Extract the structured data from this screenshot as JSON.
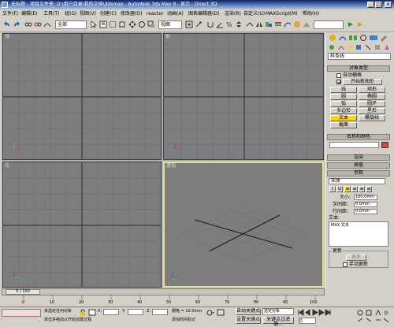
{
  "window": {
    "title": "无标题 - 项目文件夹: D:\\用户目录\\我的文档\\3dsmax - Autodesk 3ds Max 9 - 显示 : Direct 3D",
    "minimize": "_",
    "maximize": "□",
    "close": "×"
  },
  "menu": [
    "文件(F)",
    "编辑(E)",
    "工具(T)",
    "组(G)",
    "视图(V)",
    "创建(C)",
    "修改器(O)",
    "reactor",
    "动画(A)",
    "图表编辑器(D)",
    "渲染(R)",
    "自定义(U)",
    "MAXScript(M)",
    "帮助(H)"
  ],
  "toolbar": {
    "selection_filter": "全部",
    "coord_system": "视图",
    "named_selection": ""
  },
  "viewports": {
    "top": "顶",
    "front": "前",
    "left": "左",
    "perspective": "透视"
  },
  "command_panel": {
    "category_dropdown": "样条线",
    "object_type": {
      "title": "对象类型",
      "autogrid": "自动栅格",
      "start_new_shape": "开始新图形",
      "buttons": [
        "线",
        "矩形",
        "圆",
        "椭圆",
        "弧",
        "圆环",
        "多边形",
        "星形",
        "文本",
        "螺旋线",
        "截面"
      ]
    },
    "name_color": {
      "title": "名称和颜色"
    },
    "rendering": {
      "title": "渲染"
    },
    "interpolation": {
      "title": "插值"
    },
    "parameters": {
      "title": "参数",
      "font": "宋体",
      "style_buttons": [
        "I",
        "U",
        "≡",
        "≡",
        "≡",
        "≡"
      ],
      "size_label": "大小:",
      "size_value": "100.0mm",
      "kerning_label": "字间距:",
      "kerning_value": "0.0mm",
      "leading_label": "行间距:",
      "leading_value": "0.0mm",
      "text_label": "文本:",
      "text_value": "MAX 文本",
      "update_group": "更新",
      "update_button": "更新",
      "manual_update": "手动更新"
    }
  },
  "time": {
    "slider_label": "0 / 100",
    "ticks": [
      "0",
      "10",
      "20",
      "30",
      "40",
      "50",
      "60",
      "70",
      "80",
      "90",
      "100"
    ]
  },
  "status": {
    "line1": "未选定任何对象",
    "line2": "单击并拖动以开始创建过程",
    "grid_label": "栅格 = 10.0mm",
    "auto_key": "自动关键点",
    "set_key": "设置关键点",
    "key_filter_btn": "关键点过滤器...",
    "selected_objects": "选定对象",
    "add_time_tag": "添加时间标记",
    "x_label": "X:",
    "y_label": "Y:",
    "z_label": "Z:",
    "frame_value": "0"
  },
  "colors": {
    "viewport_bg": "#7d7d7d",
    "active_border": "#e6e08a",
    "highlight_button": "#ffd700",
    "swatch": "#e04040"
  }
}
